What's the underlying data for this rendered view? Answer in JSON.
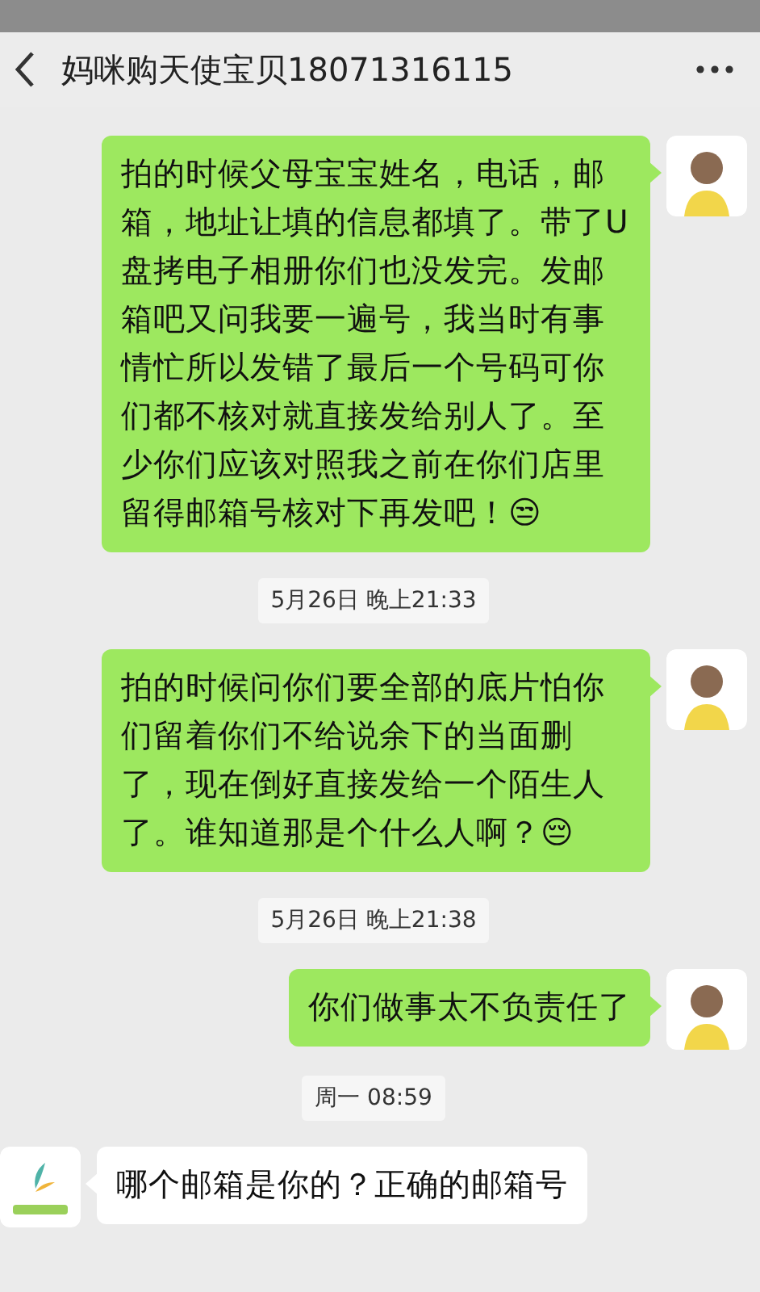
{
  "header": {
    "title": "妈咪购天使宝贝18071316115"
  },
  "messages": [
    {
      "kind": "sent",
      "text": "拍的时候父母宝宝姓名，电话，邮箱，地址让填的信息都填了。带了U盘拷电子相册你们也没发完。发邮箱吧又问我要一遍号，我当时有事情忙所以发错了最后一个号码可你们都不核对就直接发给别人了。至少你们应该对照我之前在你们店里留得邮箱号核对下再发吧！😒"
    },
    {
      "kind": "time",
      "text": "5月26日 晚上21:33"
    },
    {
      "kind": "sent",
      "text": "拍的时候问你们要全部的底片怕你们留着你们不给说余下的当面删了，现在倒好直接发给一个陌生人了。谁知道那是个什么人啊？😔"
    },
    {
      "kind": "time",
      "text": "5月26日 晚上21:38"
    },
    {
      "kind": "sent",
      "text": "你们做事太不负责任了"
    },
    {
      "kind": "time",
      "text": "周一 08:59"
    },
    {
      "kind": "received",
      "text": "哪个邮箱是你的？正确的邮箱号"
    }
  ]
}
